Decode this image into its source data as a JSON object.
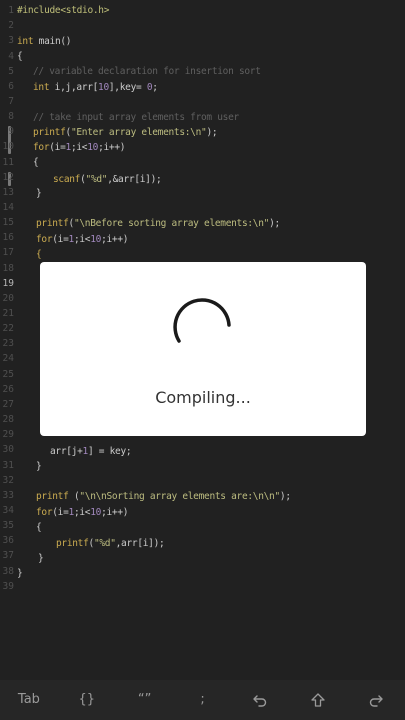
{
  "editor": {
    "gutter": [
      "1",
      "2",
      "3",
      "4",
      "5",
      "6",
      "7",
      "8",
      "9",
      "10",
      "11",
      "12",
      "13",
      "14",
      "15",
      "16",
      "17",
      "18",
      "19",
      "20",
      "21",
      "22",
      "23",
      "24",
      "25",
      "26",
      "27",
      "28",
      "29",
      "30",
      "31",
      "32",
      "33",
      "34",
      "35",
      "36",
      "37",
      "38",
      "39"
    ],
    "active_line": "19",
    "lines": {
      "l1": "#include<stdio.h>",
      "l3a": "int",
      "l3b": " main()",
      "l4": "{",
      "l5": "// variable declaration for insertion sort",
      "l6a": "int",
      "l6b": " i,j,arr[",
      "l6c": "10",
      "l6d": "],key= ",
      "l6e": "0",
      "l6f": ";",
      "l8": "// take input array elements from user",
      "l9a": "printf",
      "l9b": "(",
      "l9c": "\"Enter array elements:\\n\"",
      "l9d": ");",
      "l10a": "for",
      "l10b": "(i=",
      "l10c": "1",
      "l10d": ";i<",
      "l10e": "10",
      "l10f": ";i++)",
      "l11": "{",
      "l12a": "scanf",
      "l12b": "(",
      "l12c": "\"%d\"",
      "l12d": ",&arr[i]);",
      "l13": "}",
      "l15a": "printf",
      "l15b": "(",
      "l15c": "\"\\nBefore sorting array elements:\\n\"",
      "l15d": ");",
      "l16a": "for",
      "l16b": "(i=",
      "l16c": "1",
      "l16d": ";i<",
      "l16e": "10",
      "l16f": ";i++)",
      "l17": "{",
      "l30a": "arr[j+",
      "l30b": "1",
      "l30c": "] = key;",
      "l31": "}",
      "l33a": "printf",
      "l33b": " (",
      "l33c": "\"\\n\\nSorting array elements are:\\n\\n\"",
      "l33d": ");",
      "l34a": "for",
      "l34b": "(i=",
      "l34c": "1",
      "l34d": ";i<",
      "l34e": "10",
      "l34f": ";i++)",
      "l35": "{",
      "l36a": "printf",
      "l36b": "(",
      "l36c": "\"%d\"",
      "l36d": ",arr[i]);",
      "l37": "}",
      "l38": "}"
    }
  },
  "dialog": {
    "message": "Compiling..."
  },
  "toolbar": {
    "tab": "Tab",
    "braces": "{}",
    "quotes": "“”",
    "semicolon": ";",
    "undo_icon": "undo-icon",
    "up_icon": "arrow-up-icon",
    "redo_icon": "redo-icon"
  }
}
